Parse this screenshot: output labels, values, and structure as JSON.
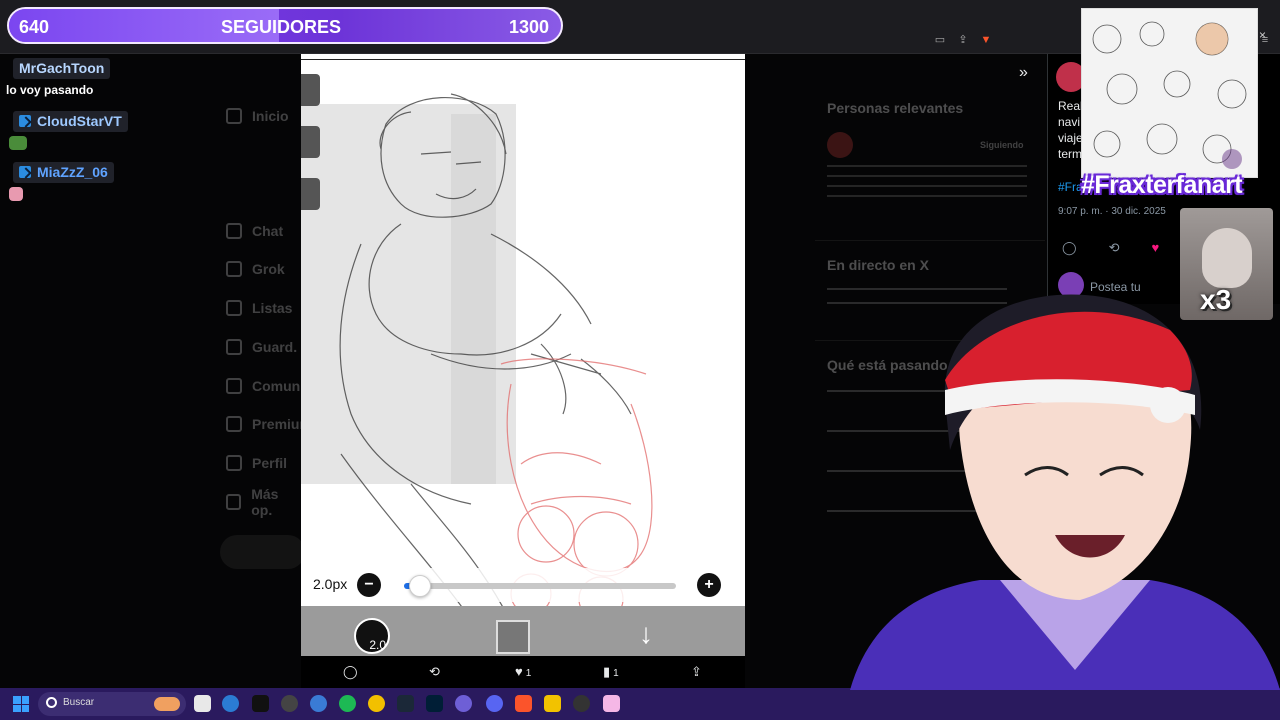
{
  "browser": {
    "url": "x.com/willsiano/status/2006185408133005502/photo/1"
  },
  "overlay": {
    "followers_current": "640",
    "followers_label": "SEGUIDORES",
    "followers_goal": "1300",
    "followers_progress_fraction": 0.49,
    "fanart_hashtag": "#Fraxterfanart",
    "cat_caption": "x3"
  },
  "chat": [
    {
      "user": "MrGachToon",
      "user_color": "#b8d7ff",
      "message": "lo voy pasando",
      "vip": false
    },
    {
      "user": "CloudStarVT",
      "user_color": "#9ec9ff",
      "message": "",
      "vip": true
    },
    {
      "user": "MiaZzZ_06",
      "user_color": "#5fa3ff",
      "message": "",
      "vip": true
    }
  ],
  "viewer": {
    "brush_size_label": "2.0px",
    "brush_size_small": "2.0",
    "slider_fraction": 0.06
  },
  "x_actions": {
    "reply": "",
    "repost": "",
    "like_count": "1",
    "views_count": "1",
    "share": ""
  },
  "x_post": {
    "text_lines": [
      "Real",
      "navi",
      "viaje",
      "term"
    ],
    "hashtag_fragment": "#Fra",
    "date": "9:07 p. m. · 30 dic. 2025",
    "reply_placeholder": "Postea tu"
  },
  "x_right": {
    "relevant_people": "Personas relevantes",
    "live_on_x": "En directo en X",
    "whats_happening": "Qué está pasando",
    "follow_label": "Siguiendo"
  },
  "x_nav": [
    "Inicio",
    "Chat",
    "Grok",
    "Listas",
    "Guard.",
    "Comun.",
    "Premium",
    "Perfil",
    "Más op."
  ],
  "taskbar": {
    "search_label": "Buscar"
  },
  "colors": {
    "overlay_purple": "#7c3aed",
    "taskbar": "#2a1a5e",
    "x_blue": "#1d9bf0",
    "like_pink": "#f91880"
  }
}
